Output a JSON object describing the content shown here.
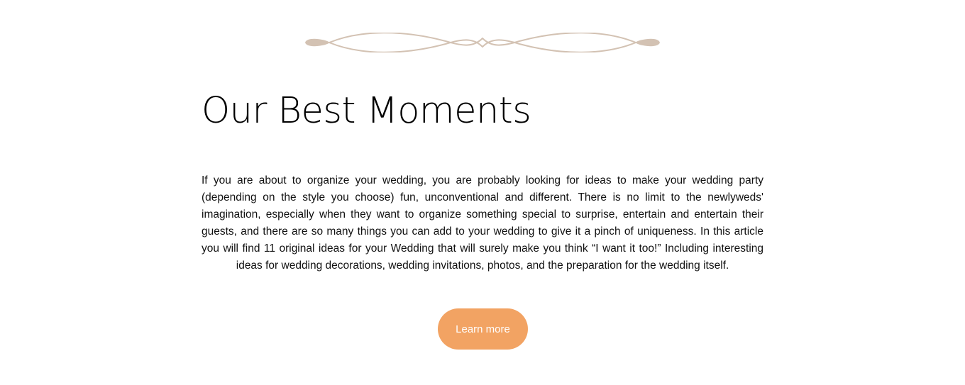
{
  "divider": {
    "icon": "ornamental-divider-icon",
    "color": "#d3c2b3"
  },
  "section": {
    "title": "Our Best Moments",
    "body": "If you are about to organize your wedding, you are probably looking for ideas to make your wedding party (depending on the style you choose) fun, unconventional and different. There is no limit to the newlyweds' imagination, especially when they want to organize something special to surprise, entertain and entertain their guests, and there are so many things you can add to your wedding to give it a pinch of uniqueness. In this article you will find 11 original ideas for your Wedding that will surely make you think “I want it too!” Including interesting ideas for wedding decorations, wedding invitations, photos, and the preparation for the wedding itself.",
    "button_label": "Learn more"
  },
  "colors": {
    "accent": "#f2a363",
    "button_text": "#ffffff",
    "text": "#000000",
    "background": "#ffffff"
  }
}
